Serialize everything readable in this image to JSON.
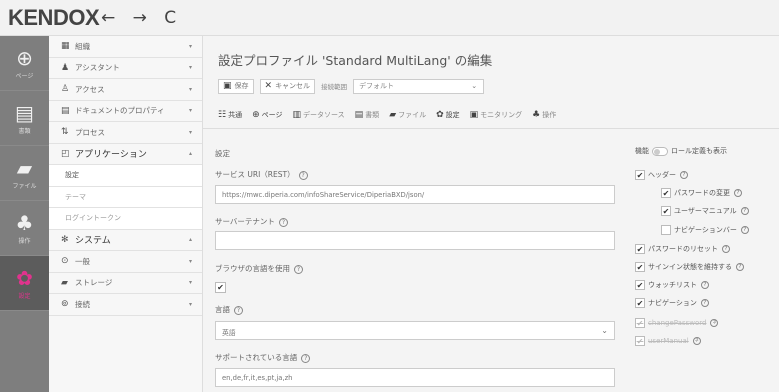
{
  "app": {
    "logo": "KENDOX",
    "nav_arrows": "← → C"
  },
  "rail": [
    {
      "icon": "globe-icon",
      "glyph": "⊕",
      "label": "ページ"
    },
    {
      "icon": "document-icon",
      "glyph": "▤",
      "label": "書類"
    },
    {
      "icon": "folder-icon",
      "glyph": "▰",
      "label": "ファイル"
    },
    {
      "icon": "workflow-icon",
      "glyph": "♣",
      "label": "操作"
    },
    {
      "icon": "gear-icon",
      "glyph": "✿",
      "label": "設定"
    }
  ],
  "menu": [
    {
      "glyph": "▦",
      "label": "組織",
      "chev": "▾"
    },
    {
      "glyph": "♟",
      "label": "アシスタント",
      "chev": "▾"
    },
    {
      "glyph": "♙",
      "label": "アクセス",
      "chev": "▾"
    },
    {
      "glyph": "▤",
      "label": "ドキュメントのプロパティ",
      "chev": "▾"
    },
    {
      "glyph": "⇅",
      "label": "プロセス",
      "chev": "▾"
    },
    {
      "glyph": "◰",
      "label": "アプリケーション",
      "chev": "▴"
    },
    {
      "glyph": "",
      "label": "設定",
      "chev": ""
    },
    {
      "glyph": "",
      "label": "テーマ",
      "chev": ""
    },
    {
      "glyph": "",
      "label": "ログイントークン",
      "chev": ""
    },
    {
      "glyph": "✻",
      "label": "システム",
      "chev": "▴"
    },
    {
      "glyph": "⊙",
      "label": "一般",
      "chev": "▾"
    },
    {
      "glyph": "▰",
      "label": "ストレージ",
      "chev": "▾"
    },
    {
      "glyph": "⊚",
      "label": "接続",
      "chev": "▾"
    }
  ],
  "page": {
    "title": "設定プロファイル 'Standard MultiLang' の編集"
  },
  "toolbar": {
    "save": "保存",
    "cancel": "キャンセル",
    "scope_label": "接続範囲",
    "scope_value": "デフォルト",
    "save_glyph": "▣",
    "cancel_glyph": "✕"
  },
  "tabs": [
    {
      "glyph": "☷",
      "label": "共通"
    },
    {
      "glyph": "⊕",
      "label": "ページ"
    },
    {
      "glyph": "▥",
      "label": "データソース"
    },
    {
      "glyph": "▤",
      "label": "書類"
    },
    {
      "glyph": "▰",
      "label": "ファイル"
    },
    {
      "glyph": "✿",
      "label": "設定"
    },
    {
      "glyph": "▣",
      "label": "モニタリング"
    },
    {
      "glyph": "♣",
      "label": "操作"
    }
  ],
  "form": {
    "section": "設定",
    "service_uri_label": "サービス URI（REST）",
    "service_uri_value": "https://mwc.diperia.com/infoShareService/DiperiaBXD/json/",
    "tenant_label": "サーバーテナント",
    "tenant_value": "",
    "browser_lang_label": "ブラウザの言語を使用",
    "browser_lang_checked": "✔",
    "lang_label": "言語",
    "lang_value": "英語",
    "supported_label": "サポートされている言語",
    "supported_value": "en,de,fr,it,es,pt,ja,zh"
  },
  "right": {
    "feature_label": "機能",
    "role_label": "ロール定義も表示",
    "items": [
      {
        "label": "ヘッダー",
        "checked": "✔",
        "indent": 0,
        "dis": false
      },
      {
        "label": "パスワードの変更",
        "checked": "✔",
        "indent": 1,
        "dis": false
      },
      {
        "label": "ユーザーマニュアル",
        "checked": "✔",
        "indent": 1,
        "dis": false
      },
      {
        "label": "ナビゲーションバー",
        "checked": "",
        "indent": 1,
        "dis": false
      },
      {
        "label": "パスワードのリセット",
        "checked": "✔",
        "indent": 0,
        "dis": false
      },
      {
        "label": "サインイン状態を維持する",
        "checked": "✔",
        "indent": 0,
        "dis": false
      },
      {
        "label": "ウォッチリスト",
        "checked": "✔",
        "indent": 0,
        "dis": false
      },
      {
        "label": "ナビゲーション",
        "checked": "✔",
        "indent": 0,
        "dis": false
      },
      {
        "label": "changePassword",
        "checked": "✔",
        "indent": 0,
        "dis": true
      },
      {
        "label": "userManual",
        "checked": "✔",
        "indent": 0,
        "dis": true
      }
    ]
  }
}
